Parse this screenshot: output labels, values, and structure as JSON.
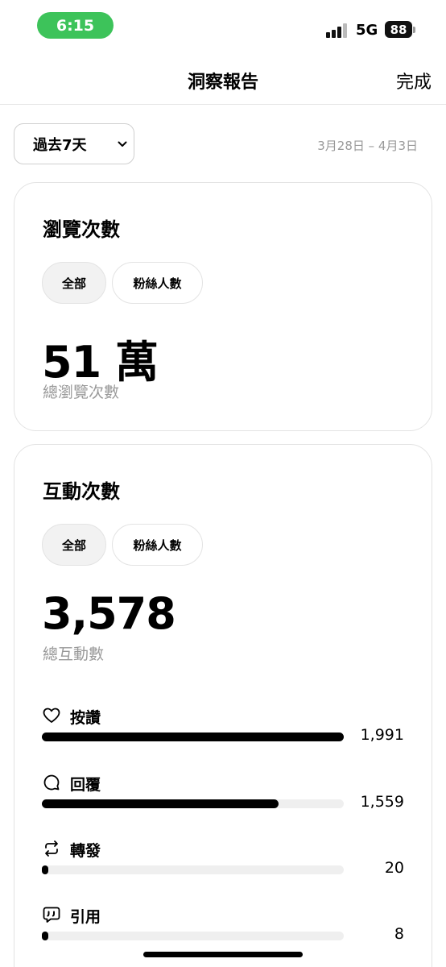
{
  "status_bar": {
    "time": "6:15",
    "network": "5G",
    "battery": "88"
  },
  "nav": {
    "title": "洞察報告",
    "done": "完成"
  },
  "filter": {
    "range_label": "過去7天",
    "date_range": "3月28日 – 4月3日"
  },
  "views_card": {
    "title": "瀏覽次數",
    "chips": {
      "all": "全部",
      "fans": "粉絲人數"
    },
    "total": "51 萬",
    "caption": "總瀏覽次數"
  },
  "interactions_card": {
    "title": "互動次數",
    "chips": {
      "all": "全部",
      "fans": "粉絲人數"
    },
    "total": "3,578",
    "caption": "總互動數",
    "metrics": [
      {
        "label": "按讚",
        "value": "1,991",
        "icon": "heart-icon",
        "fraction": 1.0
      },
      {
        "label": "回覆",
        "value": "1,559",
        "icon": "reply-bubble-icon",
        "fraction": 0.783
      },
      {
        "label": "轉發",
        "value": "20",
        "icon": "repost-icon",
        "fraction": 0.01
      },
      {
        "label": "引用",
        "value": "8",
        "icon": "quote-icon",
        "fraction": 0.004
      }
    ]
  },
  "colors": {
    "status_pill": "#3dc35a",
    "bar_fill": "#000000",
    "bar_track": "#efefef",
    "secondary_text": "#999999"
  }
}
